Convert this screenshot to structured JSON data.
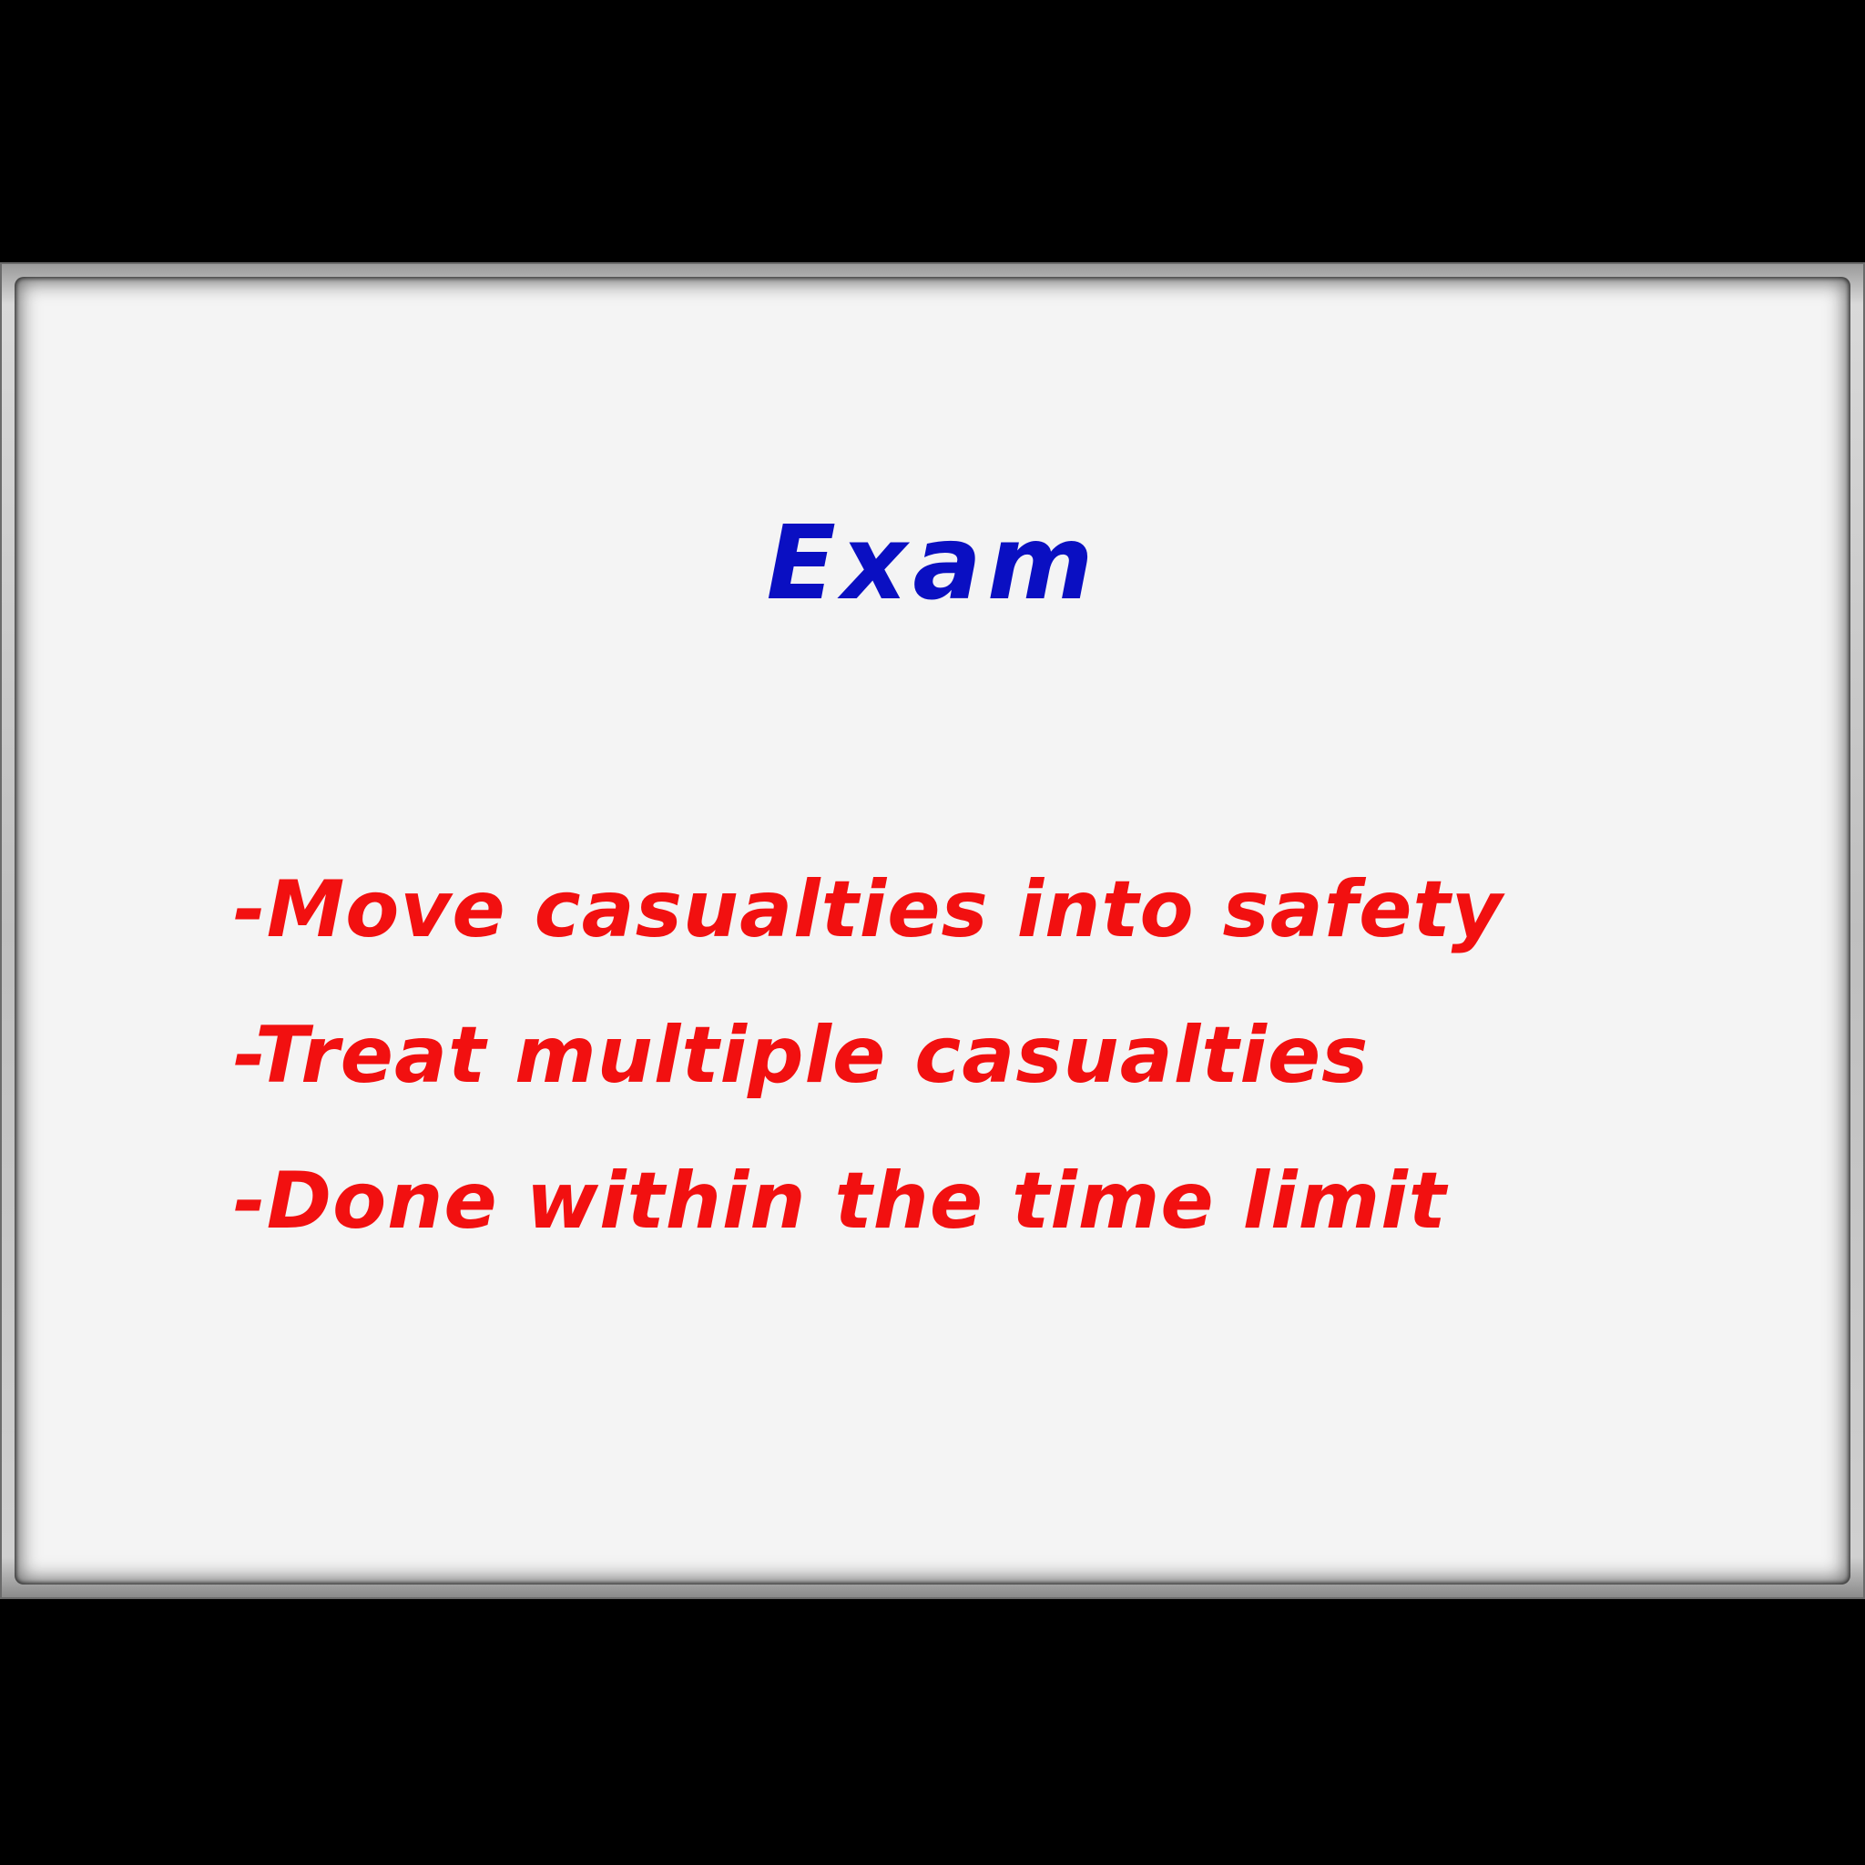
{
  "board": {
    "title": "Exam",
    "items": [
      "-Move casualties into safety",
      "-Treat multiple casualties",
      "-Done within the time limit"
    ]
  },
  "colors": {
    "background": "#000000",
    "board_surface": "#f4f4f4",
    "title_ink": "#0a0fc2",
    "item_ink": "#f21010"
  }
}
